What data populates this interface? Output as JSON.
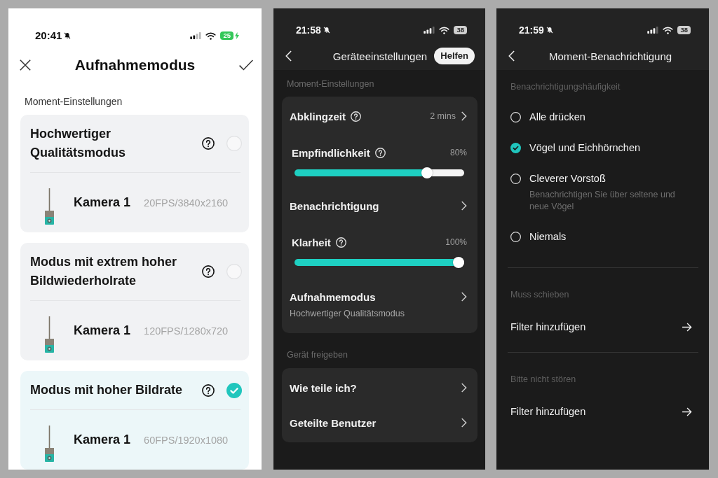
{
  "capture_mode_screen": {
    "status_bar": {
      "time": "20:41",
      "battery": "25",
      "charging": true
    },
    "title": "Aufnahmemodus",
    "section_label": "Moment-Einstellungen",
    "modes": [
      {
        "title": "Hochwertiger Qualitätsmodus",
        "selected": false,
        "camera": "Kamera 1",
        "spec": "20FPS/3840x2160"
      },
      {
        "title": "Modus mit extrem hoher Bildwiederholrate",
        "selected": false,
        "camera": "Kamera 1",
        "spec": "120FPS/1280x720"
      },
      {
        "title": "Modus mit hoher Bildrate",
        "selected": true,
        "camera": "Kamera 1",
        "spec": "60FPS/1920x1080"
      }
    ]
  },
  "device_settings_screen": {
    "status_bar": {
      "time": "21:58",
      "battery": "38",
      "charging": false
    },
    "title": "Geräteeinstellungen",
    "help_button": "Helfen",
    "sections": [
      {
        "label": "Moment-Einstellungen",
        "rows": [
          {
            "kind": "link",
            "label": "Abklingzeit",
            "help": true,
            "value": "2 mins"
          },
          {
            "kind": "slider",
            "label": "Empfindlichkeit",
            "help": true,
            "reading": "80%",
            "level": 0.8
          },
          {
            "kind": "link",
            "label": "Benachrichtigung",
            "help": false
          },
          {
            "kind": "slider",
            "label": "Klarheit",
            "help": true,
            "reading": "100%",
            "level": 1
          },
          {
            "kind": "link",
            "label": "Aufnahmemodus",
            "help": false,
            "subtitle": "Hochwertiger Qualitätsmodus"
          }
        ]
      },
      {
        "label": "Gerät freigeben",
        "rows": [
          {
            "kind": "link",
            "label": "Wie teile ich?",
            "help": false
          },
          {
            "kind": "link",
            "label": "Geteilte Benutzer",
            "help": false
          }
        ]
      }
    ]
  },
  "notification_screen": {
    "status_bar": {
      "time": "21:59",
      "battery": "38",
      "charging": false
    },
    "title": "Moment-Benachrichtigung",
    "frequency": {
      "label": "Benachrichtigungshäufigkeit",
      "options": [
        {
          "label": "Alle drücken",
          "selected": false
        },
        {
          "label": "Vögel und Eichhörnchen",
          "selected": true
        },
        {
          "label": "Cleverer Vorstoß",
          "description": "Benachrichtigen Sie über seltene und neue Vögel",
          "selected": false
        },
        {
          "label": "Niemals",
          "selected": false
        }
      ]
    },
    "filter_sections": [
      {
        "label": "Muss schieben",
        "action": "Filter hinzufügen"
      },
      {
        "label": "Bitte nicht stören",
        "action": "Filter hinzufügen"
      }
    ]
  }
}
